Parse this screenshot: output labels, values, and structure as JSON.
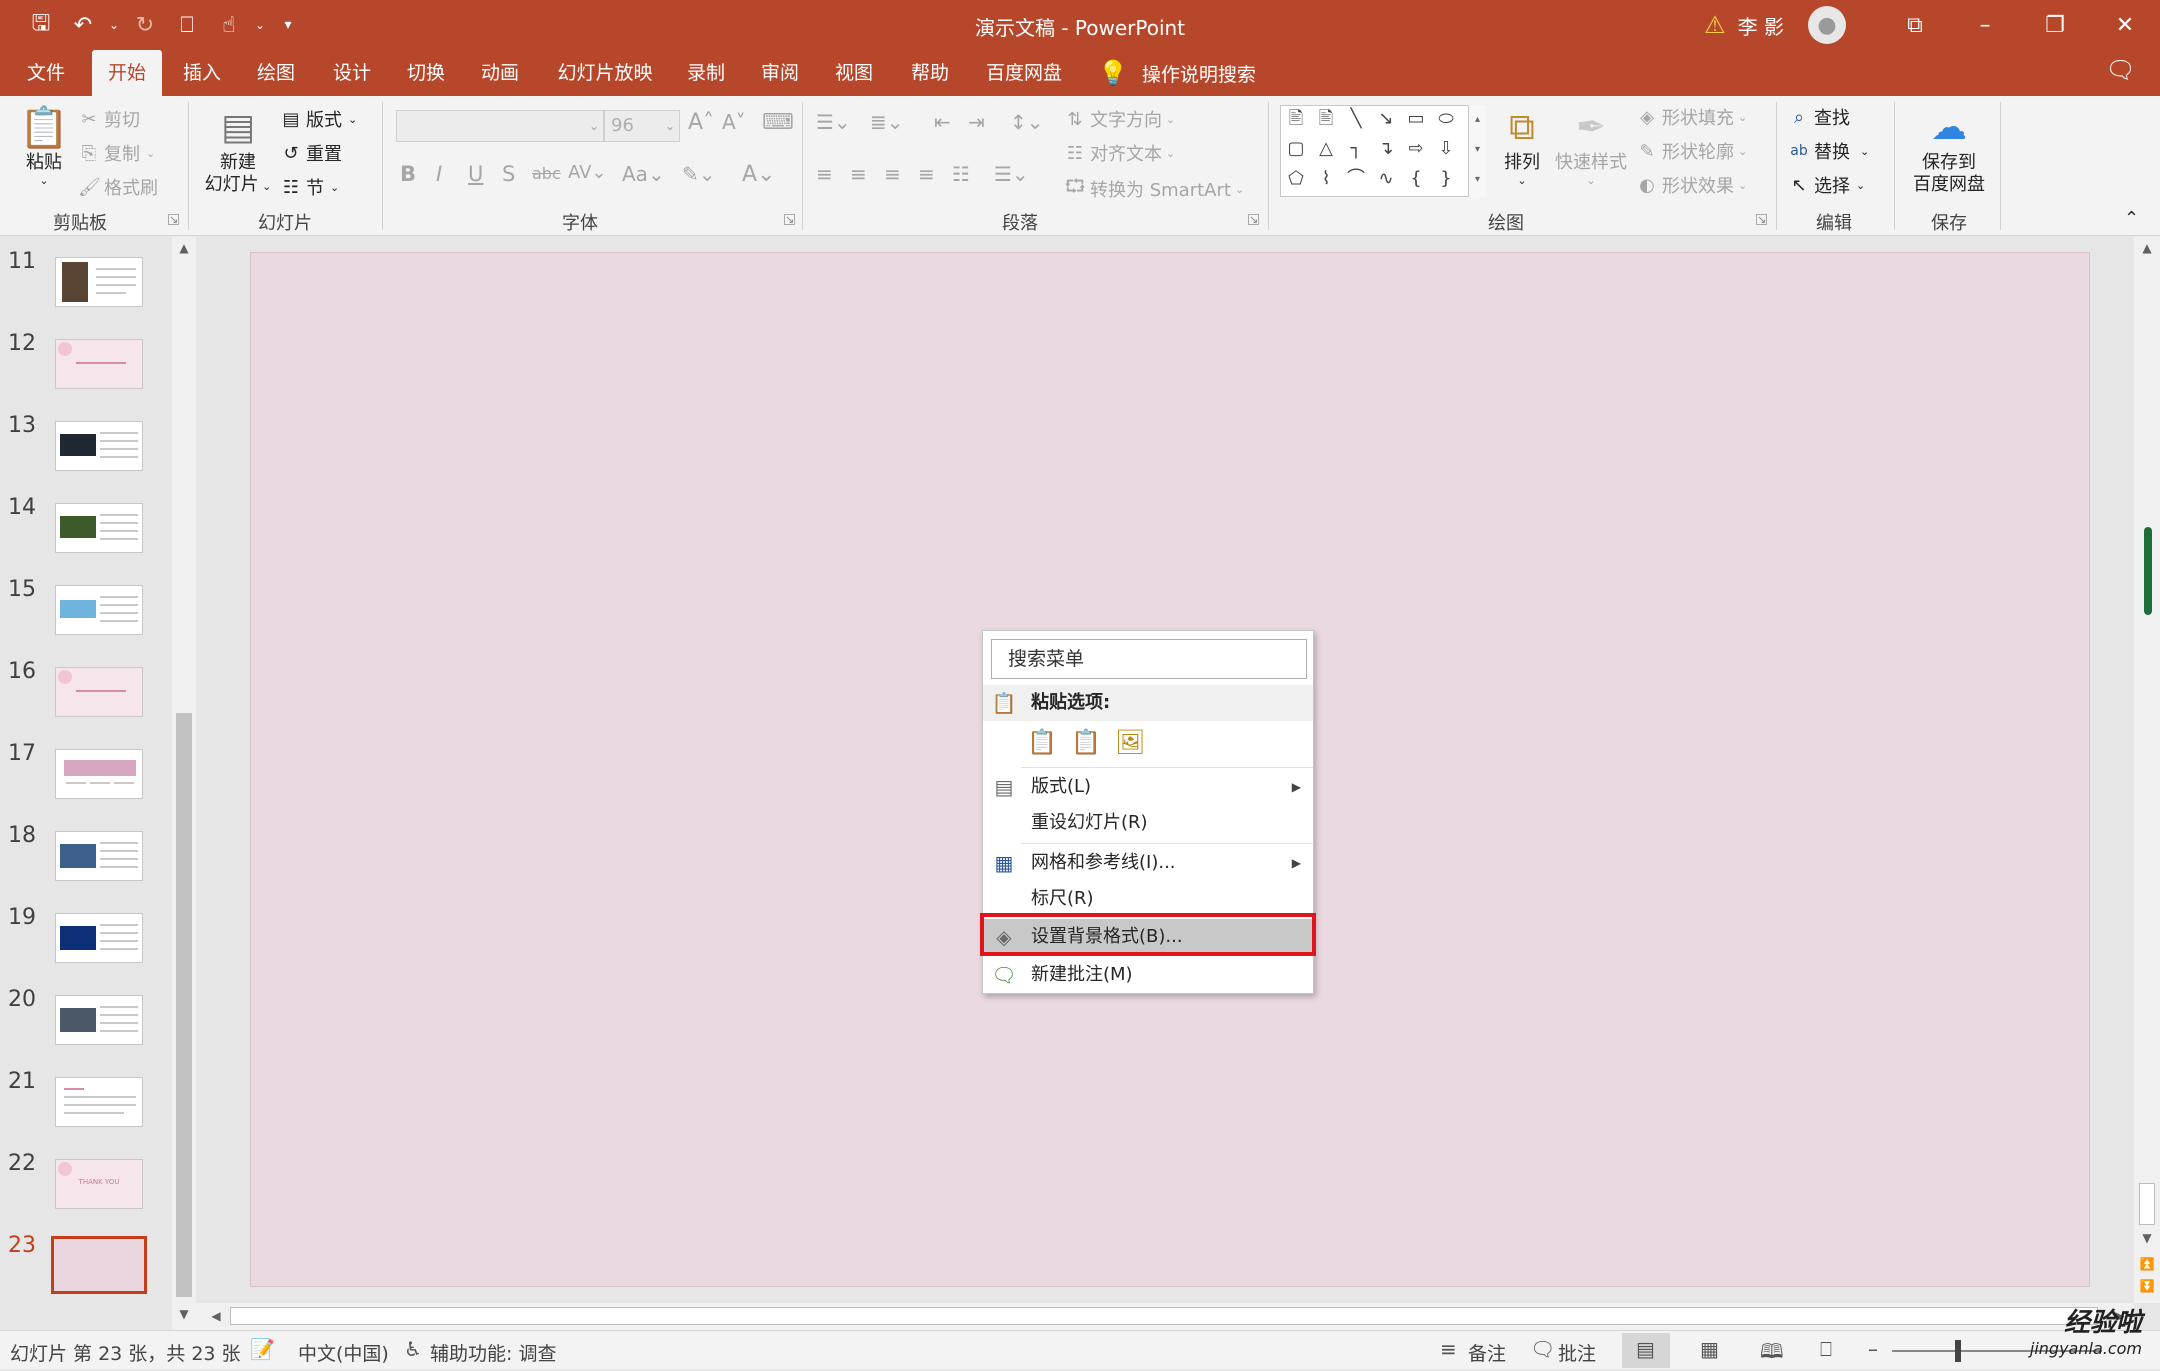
{
  "window": {
    "title": "演示文稿 - PowerPoint",
    "user_name": "李 影",
    "accent_color": "#b7472a",
    "highlight_color": "#e0141b"
  },
  "qat": {
    "save_icon": "save-icon",
    "undo_icon": "undo-icon",
    "redo_icon": "redo-icon",
    "present_icon": "slideshow-icon",
    "touch_icon": "touch-mode-icon",
    "customize_icon": "customize-icon"
  },
  "tabs": [
    "文件",
    "开始",
    "插入",
    "绘图",
    "设计",
    "切换",
    "动画",
    "幻灯片放映",
    "录制",
    "审阅",
    "视图",
    "帮助",
    "百度网盘"
  ],
  "active_tab": "开始",
  "tell_me": "操作说明搜索",
  "ribbon": {
    "clipboard": {
      "paste": "粘贴",
      "cut": "剪切",
      "copy": "复制",
      "format_painter": "格式刷",
      "label": "剪贴板"
    },
    "slides": {
      "new_slide_1": "新建",
      "new_slide_2": "幻灯片",
      "layout": "版式",
      "reset": "重置",
      "section": "节",
      "label": "幻灯片"
    },
    "font": {
      "size": "96",
      "label": "字体"
    },
    "paragraph": {
      "text_direction": "文字方向",
      "align_text": "对齐文本",
      "convert_smartart": "转换为 SmartArt",
      "label": "段落"
    },
    "drawing": {
      "arrange": "排列",
      "quick_styles": "快速样式",
      "shape_fill": "形状填充",
      "shape_outline": "形状轮廓",
      "shape_effects": "形状效果",
      "label": "绘图"
    },
    "editing": {
      "find": "查找",
      "replace": "替换",
      "select": "选择",
      "label": "编辑"
    },
    "save": {
      "save_to_1": "保存到",
      "save_to_2": "百度网盘",
      "label": "保存"
    }
  },
  "slides": {
    "numbers": [
      "11",
      "12",
      "13",
      "14",
      "15",
      "16",
      "17",
      "18",
      "19",
      "20",
      "21",
      "22",
      "23"
    ],
    "current": "23",
    "thank_you_text": "THANK YOU"
  },
  "context_menu": {
    "search": "搜索菜单",
    "paste_options": "粘贴选项:",
    "layout": "版式(L)",
    "reset_slide": "重设幻灯片(R)",
    "grid_guides": "网格和参考线(I)...",
    "ruler": "标尺(R)",
    "format_background": "设置背景格式(B)...",
    "new_comment": "新建批注(M)"
  },
  "statusbar": {
    "slide_info": "幻灯片 第 23 张，共 23 张",
    "language": "中文(中国)",
    "accessibility": "辅助功能: 调查",
    "notes": "备注",
    "comments": "批注"
  },
  "watermark": {
    "line1": "经验啦",
    "line2": "jingyanla.com"
  }
}
